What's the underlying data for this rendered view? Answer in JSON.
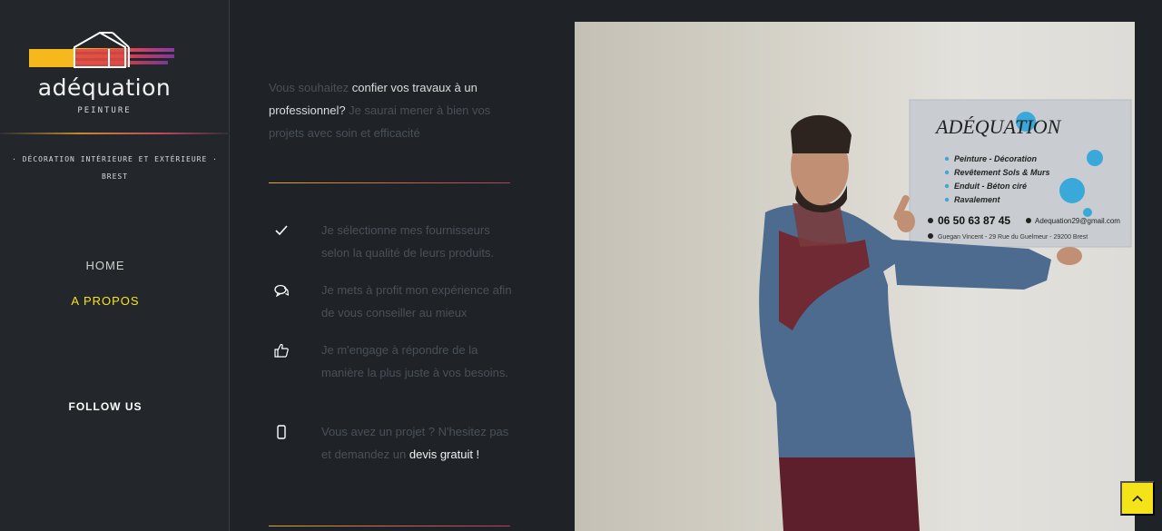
{
  "brand": {
    "name": "adéquation",
    "subtitle": "PEINTURE",
    "tagline_1": "· DÉCORATION INTÉRIEURE ET EXTÉRIEURE ·",
    "tagline_2": "BREST"
  },
  "nav": {
    "items": [
      {
        "label": "HOME",
        "active": false
      },
      {
        "label": "A PROPOS",
        "active": true
      }
    ],
    "follow_label": "FOLLOW US"
  },
  "intro": {
    "part1": "Vous souhaitez ",
    "link1": "confier vos travaux à un professionnel?",
    "part2": "  Je saurai mener à bien vos projets avec soin et efficacité"
  },
  "features": [
    {
      "icon": "checkmark-icon",
      "text": "Je sélectionne mes fournisseurs selon la qualité de leurs produits."
    },
    {
      "icon": "chat-bubbles-icon",
      "text": "Je mets à profit mon expérience afin de vous conseiller au mieux"
    },
    {
      "icon": "thumbs-up-icon",
      "text": "Je m'engage à répondre de la manière la plus juste à vos besoins."
    },
    {
      "icon": "mobile-phone-icon",
      "text": "Vous avez un projet ? N'hesitez pas et demandez un ",
      "highlight": "devis gratuit !"
    }
  ],
  "photo_sign": {
    "title": "ADÉQUATION",
    "services": [
      "Peinture - Décoration",
      "Revêtement Sols & Murs",
      "Enduit - Béton ciré",
      "Ravalement"
    ],
    "phone": "06 50 63 87 45",
    "email": "Adequation29@gmail.com",
    "address": "Guegan Vincent - 29 Rue du Guelmeur - 29200 Brest"
  },
  "colors": {
    "accent_yellow": "#f7e21b",
    "sidebar_bg": "#23272c",
    "page_bg": "#1f2328"
  },
  "scroll_top": {
    "icon": "chevron-up-icon"
  }
}
